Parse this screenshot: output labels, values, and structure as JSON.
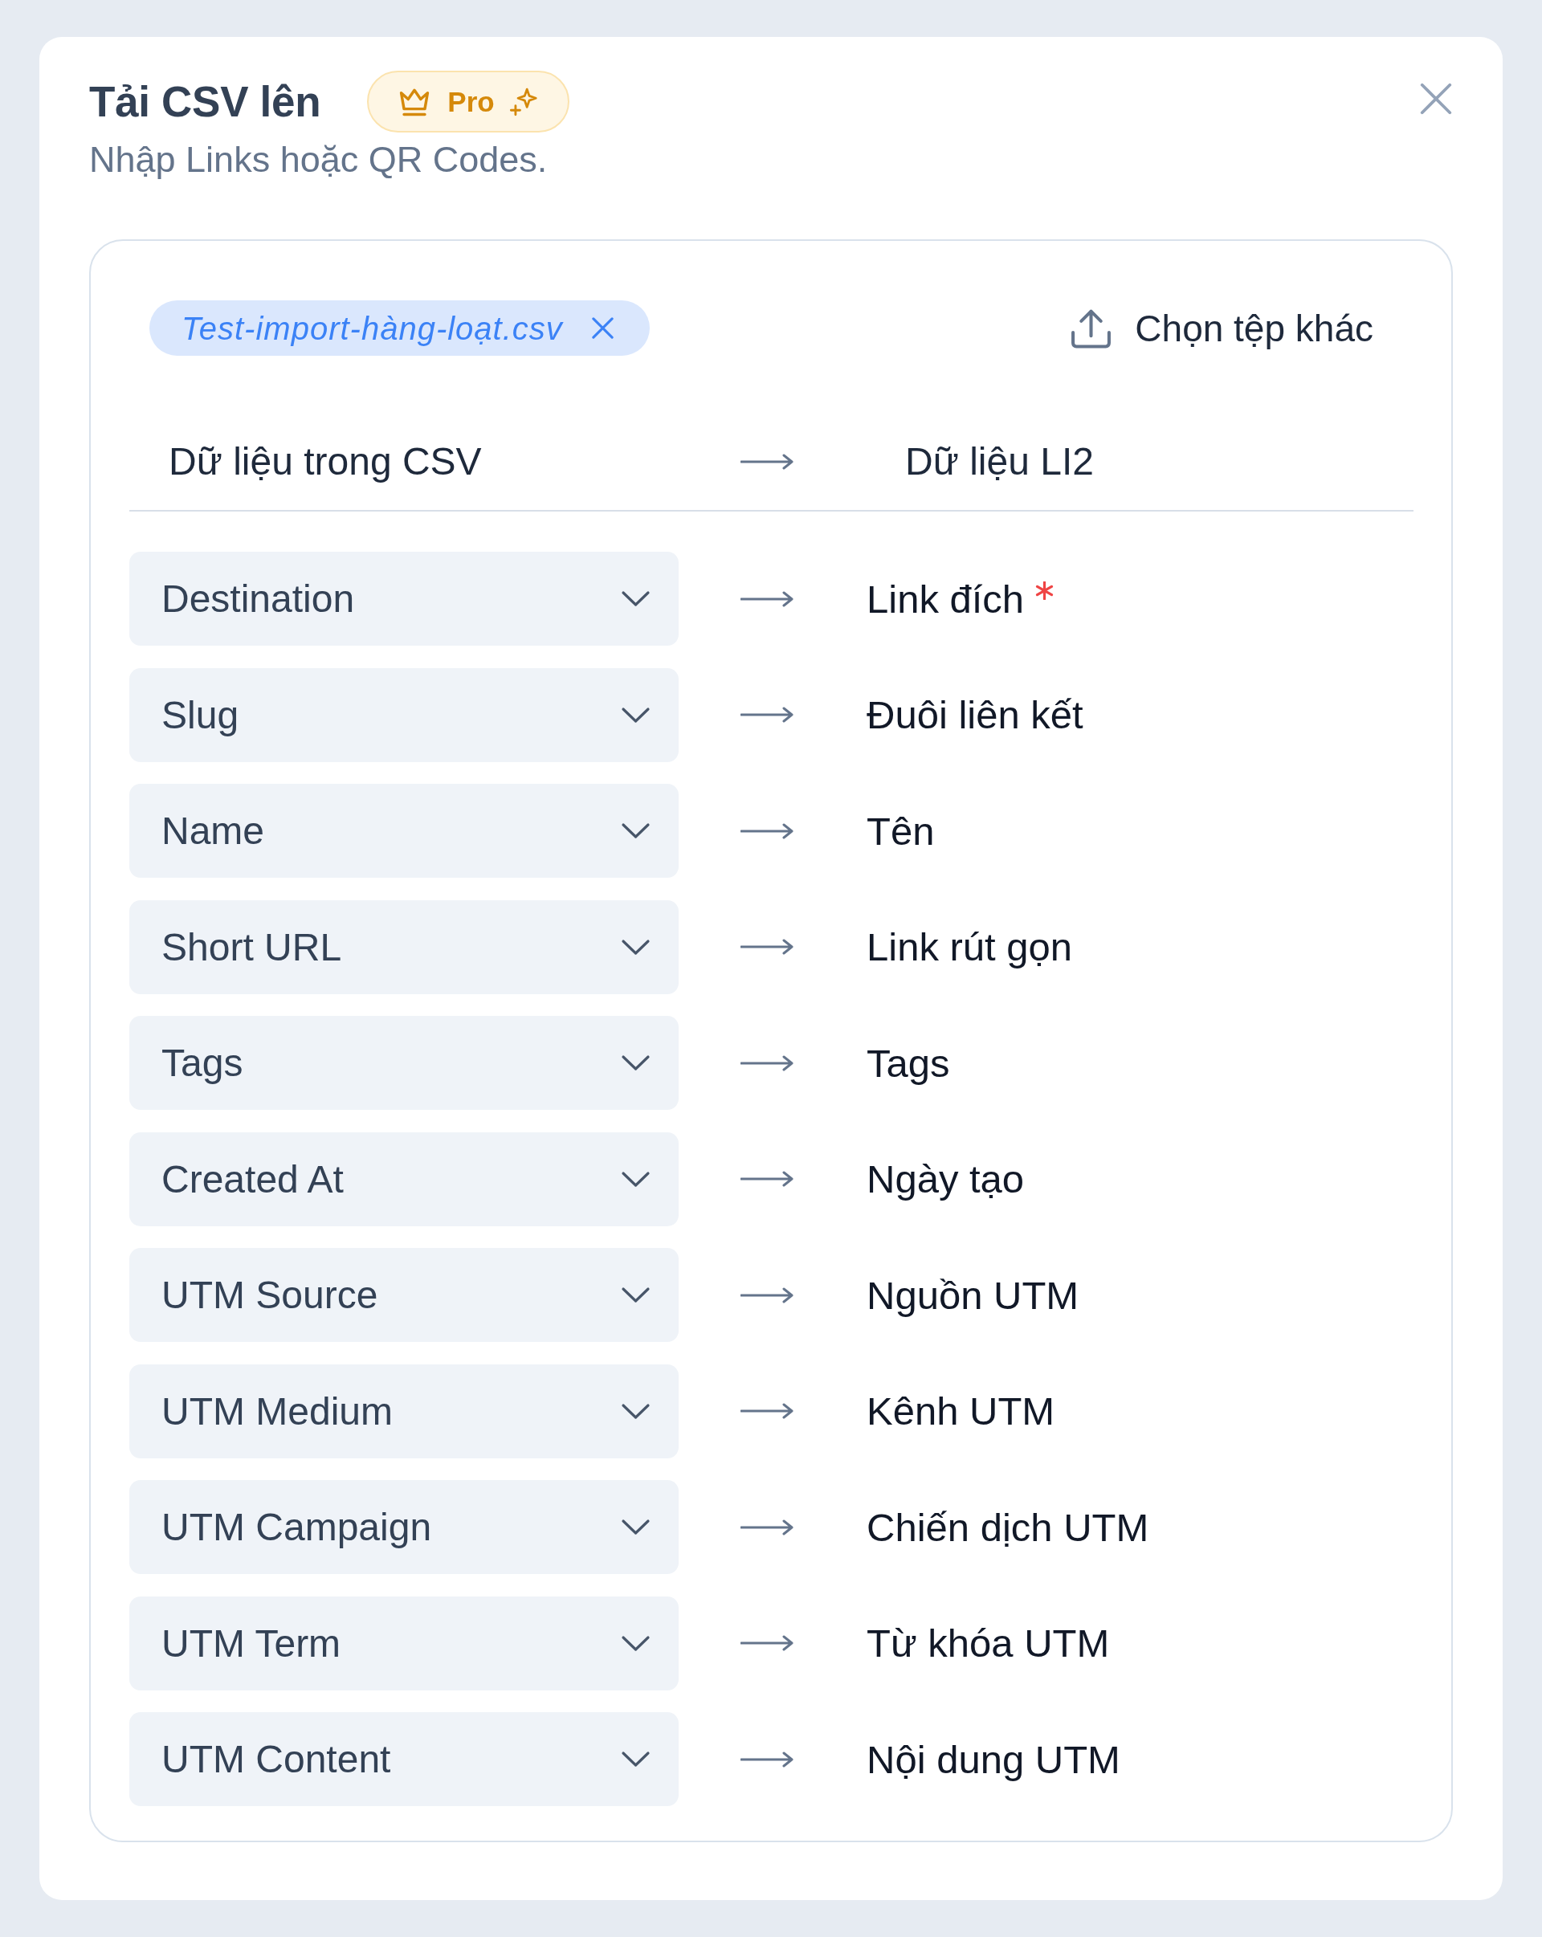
{
  "dialog": {
    "title": "Tải CSV lên",
    "badge": {
      "label": "Pro"
    },
    "subtitle": "Nhập Links hoặc QR Codes."
  },
  "file": {
    "name": "Test-import-hàng-loạt.csv"
  },
  "change_file_button": {
    "label": "Chọn tệp khác"
  },
  "mapping": {
    "columns": [
      "Dữ liệu trong CSV",
      "Dữ liệu LI2"
    ],
    "rows": [
      {
        "source": "Destination",
        "target": "Link đích",
        "required": true
      },
      {
        "source": "Slug",
        "target": "Đuôi liên kết",
        "required": false
      },
      {
        "source": "Name",
        "target": "Tên",
        "required": false
      },
      {
        "source": "Short URL",
        "target": "Link rút gọn",
        "required": false
      },
      {
        "source": "Tags",
        "target": "Tags",
        "required": false
      },
      {
        "source": "Created At",
        "target": "Ngày tạo",
        "required": false
      },
      {
        "source": "UTM Source",
        "target": "Nguồn UTM",
        "required": false
      },
      {
        "source": "UTM Medium",
        "target": "Kênh UTM",
        "required": false
      },
      {
        "source": "UTM Campaign",
        "target": "Chiến dịch UTM",
        "required": false
      },
      {
        "source": "UTM Term",
        "target": "Từ khóa UTM",
        "required": false
      },
      {
        "source": "UTM Content",
        "target": "Nội dung UTM",
        "required": false
      }
    ]
  }
}
